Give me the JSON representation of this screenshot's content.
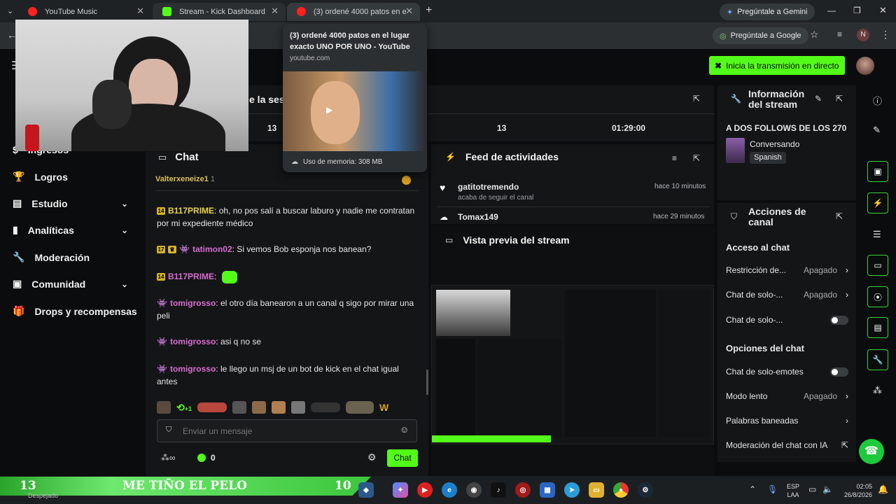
{
  "browser": {
    "tabs": [
      {
        "label": "YouTube Music"
      },
      {
        "label": "Stream - Kick Dashboard"
      },
      {
        "label": "(3) ordené 4000 patos en el lug"
      }
    ],
    "gemini": "Pregúntale a Gemini",
    "ask_google": "Pregúntale a Google",
    "profile_letter": "N"
  },
  "tooltip": {
    "title": "(3) ordené 4000 patos en el lugar exacto UNO POR UNO - YouTube",
    "domain": "youtube.com",
    "memory": "Uso de memoria: 308 MB"
  },
  "cta": {
    "label": "Inicia la transmisión en directo"
  },
  "sidebar": {
    "items": [
      {
        "label": "Ingresos"
      },
      {
        "label": "Logros"
      },
      {
        "label": "Estudio"
      },
      {
        "label": "Analíticas"
      },
      {
        "label": "Moderación"
      },
      {
        "label": "Comunidad"
      },
      {
        "label": "Drops y recompensas"
      }
    ]
  },
  "session": {
    "title_partial": "e la ses",
    "stats": [
      "13",
      "13",
      "01:29:00"
    ]
  },
  "chat": {
    "title": "Chat",
    "pinned_user": "Valterxeneize1",
    "pinned_count": "1",
    "messages": [
      {
        "badge": "14",
        "user": "B117PRIME",
        "text": ": oh, no pos salí a buscar laburo y nadie me contratan por mi expediente médico"
      },
      {
        "badge": "17",
        "user": "tatimon02",
        "text": ": Si vemos Bob esponja nos banean?"
      },
      {
        "badge": "14",
        "user": "B117PRIME",
        "text": ":"
      },
      {
        "badge": "",
        "user": "tomigrosso",
        "text": ": el otro día banearon a un canal q sigo por mirar una peli"
      },
      {
        "badge": "",
        "user": "tomigrosso",
        "text": ": asi q no se"
      },
      {
        "badge": "",
        "user": "tomigrosso",
        "text": ": le llego un msj de un bot de kick en el chat igual antes"
      }
    ],
    "emote_count": "+1",
    "placeholder": "Enviar un mensaje",
    "kicks": "0",
    "send_label": "Chat"
  },
  "feed": {
    "title": "Feed de actividades",
    "items": [
      {
        "user": "gatitotremendo",
        "action": "acaba de seguir el canal",
        "time": "hace 10 minutos"
      },
      {
        "user": "Tomax149",
        "action": "",
        "time": "hace 29 minutos"
      }
    ]
  },
  "preview": {
    "title": "Vista previa del stream"
  },
  "stream_info": {
    "title_l1": "Información",
    "title_l2": "del stream",
    "stream_title": "A DOS FOLLOWS DE LOS 270",
    "category": "Conversando",
    "language": "Spanish"
  },
  "channel_actions": {
    "title_l1": "Acciones de",
    "title_l2": "canal",
    "chat_access": "Acceso al chat",
    "rows1": [
      {
        "label": "Restricción de...",
        "value": "Apagado"
      },
      {
        "label": "Chat de solo-...",
        "value": "Apagado"
      },
      {
        "label": "Chat de solo-...",
        "value": ""
      }
    ],
    "chat_options": "Opciones del chat",
    "rows2": [
      {
        "label": "Chat de solo-emotes",
        "value": ""
      },
      {
        "label": "Modo lento",
        "value": "Apagado"
      },
      {
        "label": "Palabras baneadas",
        "value": ""
      },
      {
        "label": "Moderación del chat con IA",
        "value": ""
      }
    ]
  },
  "overlay_banner": {
    "left_num": "13",
    "text": "ME TIÑO EL PELO",
    "right_num": "10"
  },
  "taskbar": {
    "weather": "Despejado",
    "lang1": "ESP",
    "lang2": "LAA",
    "time": "02:05",
    "date": "26/8/2026"
  },
  "colors": {
    "kick_green": "#53fc18",
    "gold": "#e7d44f",
    "pink": "#d86bd1"
  }
}
